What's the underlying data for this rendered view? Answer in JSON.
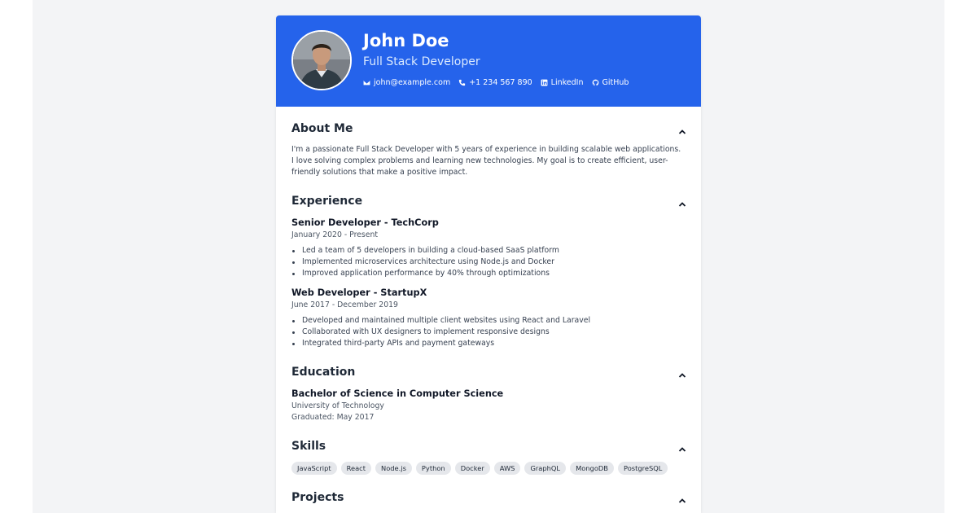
{
  "header": {
    "name": "John Doe",
    "role": "Full Stack Developer",
    "contacts": {
      "email": "john@example.com",
      "phone": "+1 234 567 890",
      "linkedin": "LinkedIn",
      "github": "GitHub"
    },
    "accent_color": "#2563eb"
  },
  "about": {
    "title": "About Me",
    "lines": [
      "I'm a passionate Full Stack Developer with 5 years of experience in building scalable web applications.",
      "I love solving complex problems and learning new technologies. My goal is to create efficient, user-",
      "friendly solutions that make a positive impact."
    ]
  },
  "experience": {
    "title": "Experience",
    "jobs": [
      {
        "title": "Senior Developer - TechCorp",
        "dates": "January 2020 - Present",
        "bullets": [
          "Led a team of 5 developers in building a cloud-based SaaS platform",
          "Implemented microservices architecture using Node.js and Docker",
          "Improved application performance by 40% through optimizations"
        ]
      },
      {
        "title": "Web Developer - StartupX",
        "dates": "June 2017 - December 2019",
        "bullets": [
          "Developed and maintained multiple client websites using React and Laravel",
          "Collaborated with UX designers to implement responsive designs",
          "Integrated third-party APIs and payment gateways"
        ]
      }
    ]
  },
  "education": {
    "title": "Education",
    "degree": "Bachelor of Science in Computer Science",
    "school": "University of Technology",
    "graduated": "Graduated: May 2017"
  },
  "skills": {
    "title": "Skills",
    "items": [
      "JavaScript",
      "React",
      "Node.js",
      "Python",
      "Docker",
      "AWS",
      "GraphQL",
      "MongoDB",
      "PostgreSQL"
    ]
  },
  "projects": {
    "title": "Projects"
  },
  "icons": {
    "email": "envelope-icon",
    "phone": "phone-icon",
    "linkedin": "linkedin-icon",
    "github": "github-icon",
    "collapse": "chevron-up-icon"
  }
}
